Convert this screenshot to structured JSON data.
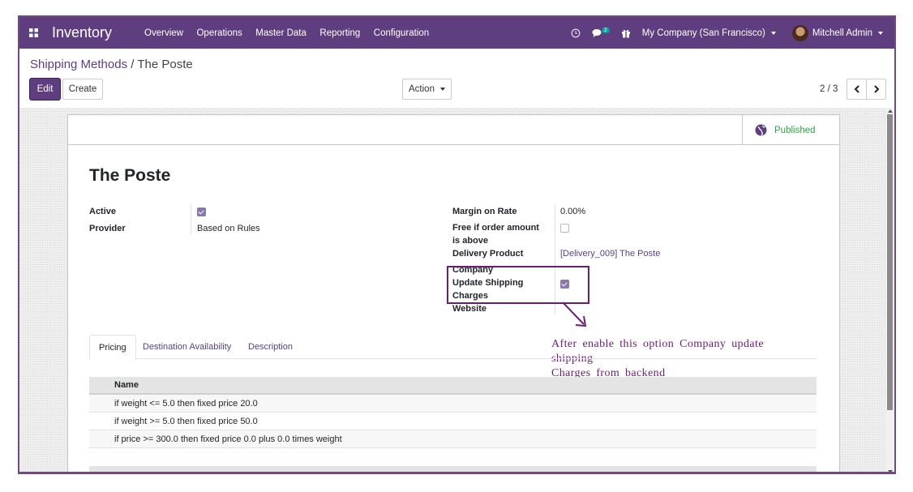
{
  "navbar": {
    "app_title": "Inventory",
    "menu": [
      "Overview",
      "Operations",
      "Master Data",
      "Reporting",
      "Configuration"
    ],
    "message_count": "2",
    "company": "My Company (San Francisco)",
    "user": "Mitchell Admin"
  },
  "breadcrumb": {
    "parent": "Shipping Methods",
    "separator": "/",
    "current": "The Poste"
  },
  "buttons": {
    "edit": "Edit",
    "create": "Create",
    "action": "Action"
  },
  "pager": {
    "value": "2 / 3"
  },
  "record": {
    "status": "Published",
    "title": "The Poste",
    "left_fields": [
      {
        "label": "Active",
        "checked": true
      },
      {
        "label": "Provider",
        "value": "Based on Rules"
      }
    ],
    "right_fields": {
      "margin_label": "Margin on Rate",
      "margin_value": "0.00%",
      "free_label_1": "Free if order amount",
      "free_label_2": "is above",
      "free_checked": false,
      "product_label": "Delivery Product",
      "product_value": "[Delivery_009] The Poste",
      "company_label": "Company",
      "update_label_1": "Update Shipping",
      "update_label_2": "Charges",
      "update_checked": true,
      "website_label": "Website"
    }
  },
  "annotation": {
    "line1": "After enable this option Company update shipping",
    "line2": "Charges from backend",
    "color": "#6a1e70"
  },
  "tabs": [
    "Pricing",
    "Destination Availability",
    "Description"
  ],
  "active_tab": "Pricing",
  "table": {
    "header": "Name",
    "rows": [
      "if weight <= 5.0 then fixed price 20.0",
      "if weight >= 5.0 then fixed price 50.0",
      "if price >= 300.0 then fixed price 0.0 plus 0.0 times weight"
    ]
  },
  "colors": {
    "brand": "#5e3e7f",
    "published": "#28a745"
  }
}
